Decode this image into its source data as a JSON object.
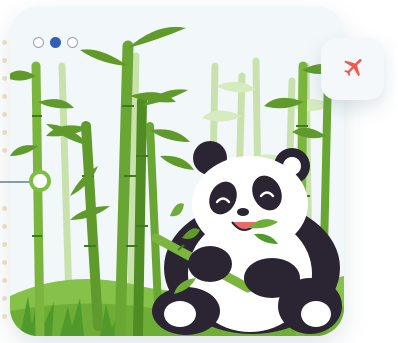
{
  "carousel": {
    "slide_count": 3,
    "active_index": 1
  },
  "icons": {
    "plane_button": "airplane-icon"
  },
  "colors": {
    "card_background": "#f2f8fa",
    "active_dot": "#2f5fb8",
    "inactive_dot_border": "#9aa3ad",
    "bamboo_dark": "#5f9a2a",
    "bamboo_light": "#b9d89a",
    "grass": "#7ab83e",
    "plane": "#ef5b4f",
    "panda_black": "#2b2433",
    "panda_white": "#ffffff"
  },
  "illustration": {
    "subject": "panda-eating-bamboo"
  }
}
